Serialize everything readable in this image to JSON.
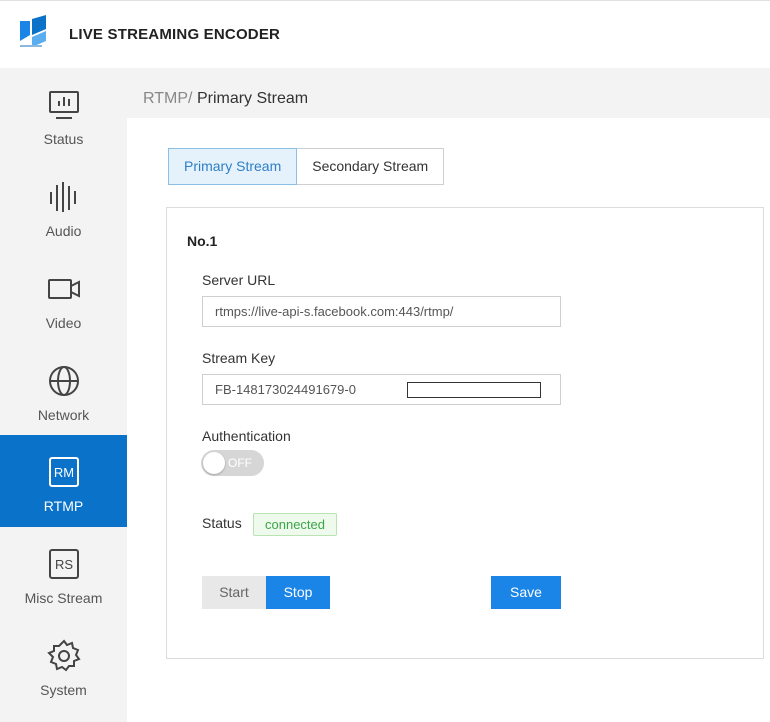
{
  "app": {
    "title": "LIVE STREAMING ENCODER"
  },
  "sidebar": {
    "items": [
      {
        "label": "Status",
        "icon": "status-monitor-icon",
        "active": false
      },
      {
        "label": "Audio",
        "icon": "audio-waveform-icon",
        "active": false
      },
      {
        "label": "Video",
        "icon": "video-camera-icon",
        "active": false
      },
      {
        "label": "Network",
        "icon": "globe-icon",
        "active": false
      },
      {
        "label": "RTMP",
        "icon": "rtmp-box-icon",
        "active": true
      },
      {
        "label": "Misc Stream",
        "icon": "rs-box-icon",
        "active": false
      },
      {
        "label": "System",
        "icon": "gear-icon",
        "active": false
      }
    ],
    "active_color": "#0a72c9"
  },
  "breadcrumb": {
    "parent": "RTMP/",
    "current": "Primary Stream"
  },
  "tabs": [
    {
      "label": "Primary Stream",
      "active": true
    },
    {
      "label": "Secondary Stream",
      "active": false
    }
  ],
  "stream": {
    "title": "No.1",
    "server_url_label": "Server URL",
    "server_url_value": "rtmps://live-api-s.facebook.com:443/rtmp/",
    "stream_key_label": "Stream Key",
    "stream_key_value": "FB-148173024491679-0",
    "authentication_label": "Authentication",
    "authentication_state": "OFF",
    "status_label": "Status",
    "status_value": "connected"
  },
  "buttons": {
    "start": "Start",
    "stop": "Stop",
    "save": "Save"
  },
  "colors": {
    "primary": "#1a85e6",
    "success": "#3aa64a"
  }
}
